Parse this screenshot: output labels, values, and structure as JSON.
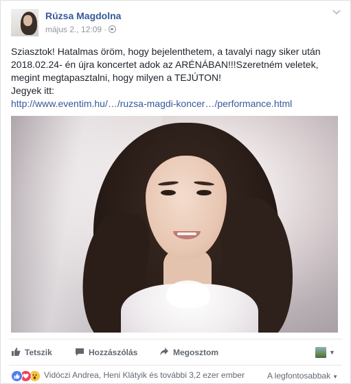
{
  "post": {
    "author": "Rúzsa Magdolna",
    "date": "május 2., 12:09",
    "separator": "·",
    "privacy_icon": "globe-icon",
    "menu_icon": "chevron-down-icon",
    "text_lines": [
      "Sziasztok! Hatalmas öröm, hogy bejelenthetem, a tavalyi nagy siker után 2018.02.24- én újra koncertet adok az ARÉNÁBAN!!!Szeretném veletek, megint megtapasztalni, hogy milyen a TEJÚTON!",
      "Jegyek itt:"
    ],
    "link": "http://www.eventim.hu/…/ruzsa-magdi-koncer…/performance.html"
  },
  "actions": {
    "like_label": "Tetszik",
    "comment_label": "Hozzászólás",
    "share_label": "Megosztom"
  },
  "reactions": {
    "icons": [
      "like",
      "love",
      "wow"
    ],
    "summary": "Vidóczi Andrea, Heni Klátyik és további 3,2 ezer ember",
    "sort_label": "A legfontosabbak"
  },
  "colors": {
    "link": "#365899",
    "meta": "#90949c",
    "action": "#606770",
    "like": "#4d7cf3",
    "love": "#f0415a",
    "wow": "#f7c240"
  }
}
